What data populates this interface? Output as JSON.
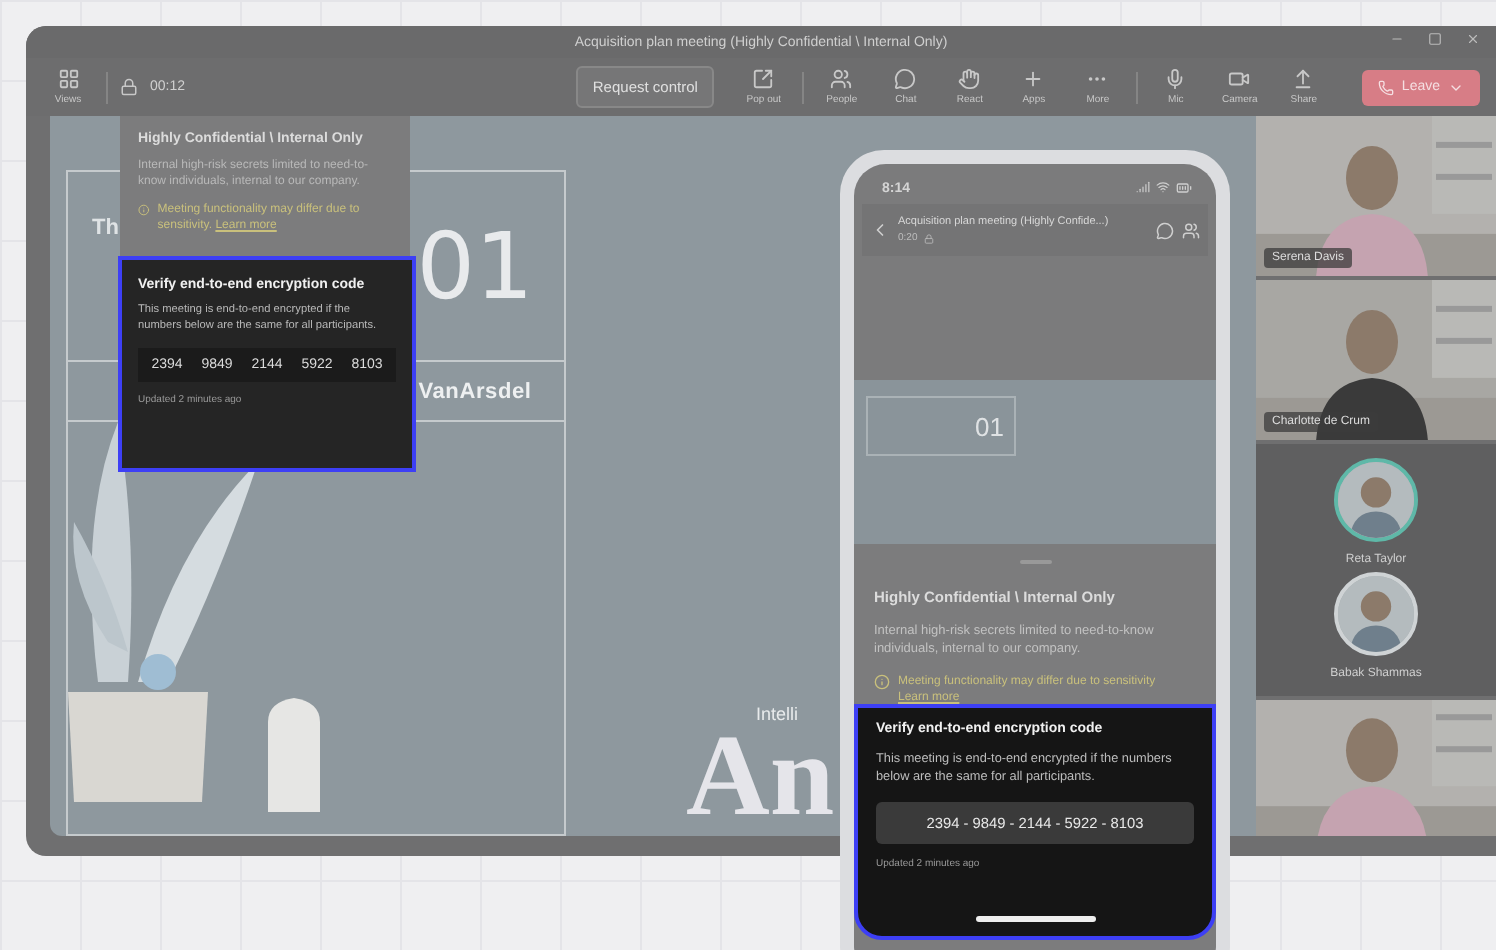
{
  "window": {
    "title": "Acquisition plan meeting (Highly Confidential \\ Internal Only)"
  },
  "toolbar": {
    "views": "Views",
    "timer": "00:12",
    "request_control": "Request control",
    "buttons": [
      {
        "kind": "popout",
        "label": "Pop out"
      },
      {
        "kind": "people",
        "label": "People"
      },
      {
        "kind": "chat",
        "label": "Chat"
      },
      {
        "kind": "react",
        "label": "React"
      },
      {
        "kind": "apps",
        "label": "Apps"
      },
      {
        "kind": "more",
        "label": "More"
      },
      {
        "kind": "mic",
        "label": "Mic"
      },
      {
        "kind": "camera",
        "label": "Camera"
      },
      {
        "kind": "share",
        "label": "Share"
      }
    ],
    "leave": "Leave"
  },
  "slide": {
    "heading": "Th",
    "number": "01",
    "brand": "VanArsdel",
    "subtitle": "Intelli",
    "big_title": "An"
  },
  "confidential_popup": {
    "title": "Highly Confidential \\ Internal Only",
    "body": "Internal high-risk secrets limited to need-to-know individuals, internal to our company.",
    "warning": "Meeting functionality may differ due to sensitivity.",
    "link": "Learn more"
  },
  "encryption_popup": {
    "title": "Verify end-to-end encryption code",
    "body": "This meeting is end-to-end encrypted if the numbers below are the same for all participants.",
    "numbers": [
      "2394",
      "9849",
      "2144",
      "5922",
      "8103"
    ],
    "updated": "Updated 2 minutes ago"
  },
  "participants": [
    {
      "kind": "video",
      "name": "Serena Davis"
    },
    {
      "kind": "video",
      "name": "Charlotte de Crum"
    },
    {
      "kind": "avatar",
      "name": "Reta Taylor",
      "speaking": true
    },
    {
      "kind": "avatar",
      "name": "Babak Shammas",
      "speaking": false
    },
    {
      "kind": "video"
    }
  ],
  "phone": {
    "time": "8:14",
    "meeting_title": "Acquisition plan meeting (Highly Confide...)",
    "duration": "0:20",
    "slide_number": "01",
    "sheet": {
      "title": "Highly Confidential \\ Internal Only",
      "body": "Internal high-risk secrets limited to need-to-know individuals, internal to our company.",
      "warning": "Meeting functionality may differ due to sensitivity",
      "link": "Learn more"
    },
    "encryption": {
      "title": "Verify end-to-end encryption code",
      "body": "This meeting is end-to-end encrypted if the numbers below are the same for all participants.",
      "code": "2394 - 9849 - 2144 - 5922 - 8103",
      "updated": "Updated 2 minutes ago"
    }
  }
}
